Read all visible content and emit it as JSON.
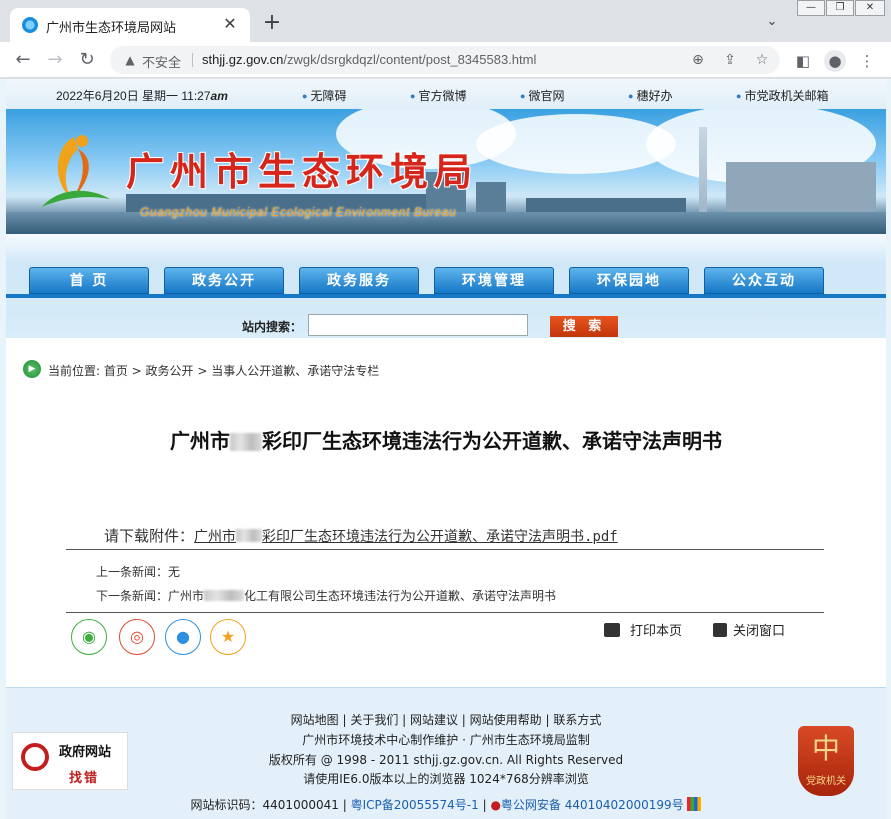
{
  "browser": {
    "tab_title": "广州市生态环境局网站",
    "new_tab": "+",
    "insecure_label": "不安全",
    "url_host": "sthjj.gz.gov.cn",
    "url_path": "/zwgk/dsrgkdqzl/content/post_8345583.html"
  },
  "topbar": {
    "date": "2022年6月20日 星期一 11:27",
    "ampm": "am",
    "links": [
      "无障碍",
      "官方微博",
      "微官网",
      "穗好办",
      "市党政机关邮箱"
    ]
  },
  "banner": {
    "title_cn": "广州市生态环境局",
    "title_en": "Guangzhou Municipal Ecological Environment Bureau"
  },
  "nav": {
    "items": [
      "首  页",
      "政务公开",
      "政务服务",
      "环境管理",
      "环保园地",
      "公众互动"
    ]
  },
  "search": {
    "label": "站内搜索：",
    "placeholder": "",
    "button": "搜 索"
  },
  "breadcrumb": "当前位置: 首页 > 政务公开 > 当事人公开道歉、承诺守法专栏",
  "article": {
    "title_prefix": "广州市",
    "title_suffix": "彩印厂生态环境违法行为公开道歉、承诺守法声明书",
    "download_label": "请下载附件：",
    "download_prefix": "广州市",
    "download_suffix": "彩印厂生态环境违法行为公开道歉、承诺守法声明书.pdf",
    "prev": "上一条新闻：无",
    "next_prefix": "下一条新闻：广州市",
    "next_suffix": "化工有限公司生态环境违法行为公开道歉、承诺守法声明书",
    "print": "打印本页",
    "close": "关闭窗口"
  },
  "footer": {
    "links": "网站地图 | 关于我们 | 网站建议 | 网站使用帮助 | 联系方式",
    "line2": "广州市环境技术中心制作维护 · 广州市生态环境局监制",
    "line3": "版权所有 @ 1998 - 2011 sthjj.gz.gov.cn. All Rights Reserved",
    "line4": "请使用IE6.0版本以上的浏览器 1024*768分辨率浏览",
    "site_id_label": "网站标识码：4401000041",
    "icp": "粤ICP备20055574号-1",
    "police": "粤公网安备 44010402000199号",
    "find_error_1": "政府网站",
    "find_error_2": "找错",
    "party_label": "党政机关"
  },
  "colors": {
    "nav_blue": "#1677c7",
    "search_button": "#d4400f",
    "brand_red": "#d6251b"
  }
}
